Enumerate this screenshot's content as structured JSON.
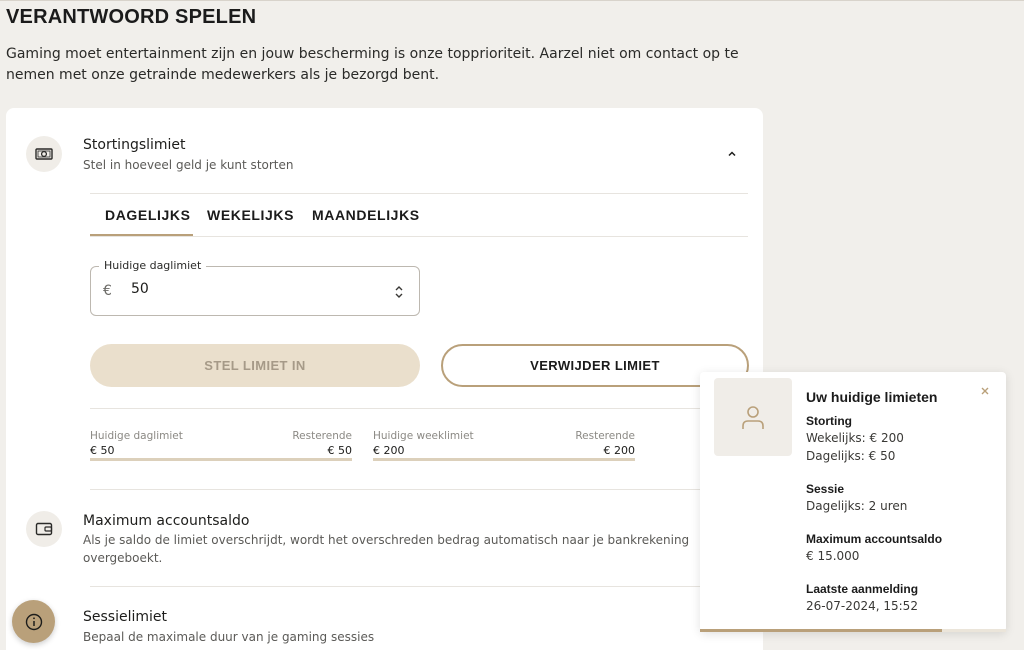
{
  "page": {
    "title": "VERANTWOORD SPELEN",
    "intro": "Gaming moet entertainment zijn en jouw bescherming is onze topprioriteit. Aarzel niet om contact op te nemen met onze getrainde medewerkers als je bezorgd bent."
  },
  "deposit": {
    "icon": "banknote-icon",
    "title": "Stortingslimiet",
    "subtitle": "Stel in hoeveel geld je kunt storten",
    "tabs": [
      {
        "label": "DAGELIJKS",
        "active": true
      },
      {
        "label": "WEKELIJKS",
        "active": false
      },
      {
        "label": "MAANDELIJKS",
        "active": false
      }
    ],
    "field": {
      "label": "Huidige daglimiet",
      "currency": "€",
      "value": "50"
    },
    "set_button": "STEL LIMIET IN",
    "remove_button": "VERWIJDER LIMIET",
    "stats": [
      {
        "label": "Huidige daglimiet",
        "value": "€ 50",
        "remaining_label": "Resterende",
        "remaining_value": "€ 50",
        "fill": 1.0
      },
      {
        "label": "Huidige weeklimiet",
        "value": "€ 200",
        "remaining_label": "Resterende",
        "remaining_value": "€ 200",
        "fill": 1.0
      }
    ]
  },
  "balance": {
    "icon": "wallet-icon",
    "title": "Maximum accountsaldo",
    "subtitle": "Als je saldo de limiet overschrijdt, wordt het overschreden bedrag automatisch naar je bankrekening overgeboekt."
  },
  "session": {
    "title": "Sessielimiet",
    "subtitle": "Bepaal de maximale duur van je gaming sessies"
  },
  "popup": {
    "title": "Uw huidige limieten",
    "deposit_heading": "Storting",
    "deposit_weekly": "Wekelijks: € 200",
    "deposit_daily": "Dagelijks: € 50",
    "session_heading": "Sessie",
    "session_daily": "Dagelijks: 2 uren",
    "balance_heading": "Maximum accountsaldo",
    "balance_value": "€ 15.000",
    "login_heading": "Laatste aanmelding",
    "login_value": "26-07-2024, 15:52",
    "progress": 0.79
  },
  "colors": {
    "accent": "#b9a07a",
    "background": "#f1efeb"
  }
}
